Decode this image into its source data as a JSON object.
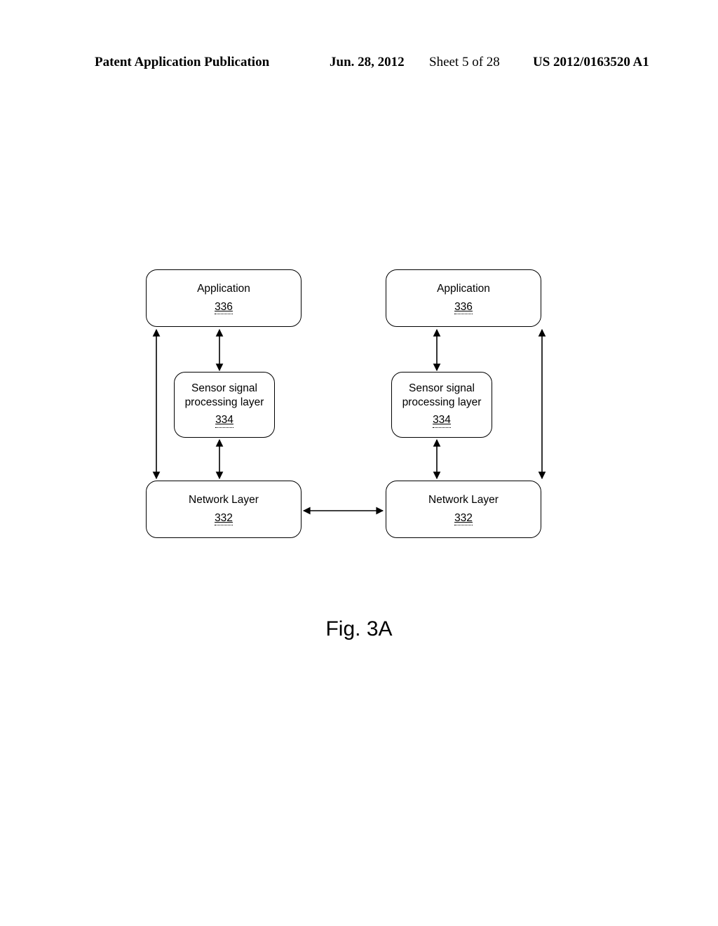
{
  "header": {
    "publication": "Patent Application Publication",
    "date": "Jun. 28, 2012",
    "sheet": "Sheet 5 of 28",
    "patnum": "US 2012/0163520 A1"
  },
  "figure_label": "Fig. 3A",
  "nodes": {
    "app_left": {
      "title": "Application",
      "num": "336"
    },
    "app_right": {
      "title": "Application",
      "num": "336"
    },
    "sensor_left": {
      "line1": "Sensor signal",
      "line2": "processing layer",
      "num": "334"
    },
    "sensor_right": {
      "line1": "Sensor signal",
      "line2": "processing layer",
      "num": "334"
    },
    "net_left": {
      "title": "Network Layer",
      "num": "332"
    },
    "net_right": {
      "title": "Network Layer",
      "num": "332"
    }
  }
}
